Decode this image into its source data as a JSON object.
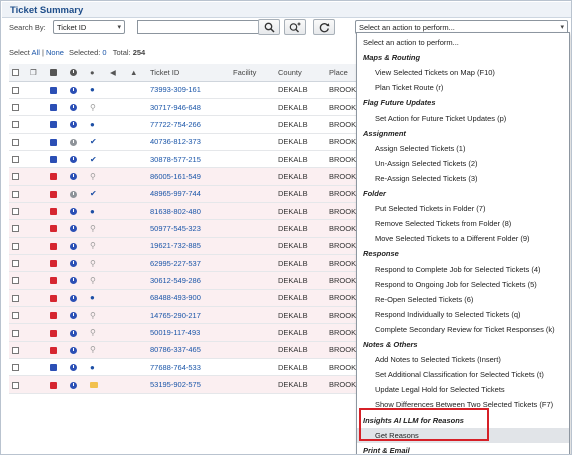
{
  "panel": {
    "title": "Ticket Summary"
  },
  "search": {
    "label": "Search By:",
    "field_value": "Ticket ID",
    "query_value": "",
    "action_select_value": "Select an action to perform..."
  },
  "selection": {
    "prefix": "Select",
    "all_label": "All",
    "none_label": "None",
    "selected_label": "Selected:",
    "selected_count": "0",
    "total_label": "Total:",
    "total_count": "254"
  },
  "table": {
    "headers": {
      "ticket_id": "Ticket ID",
      "facility": "Facility",
      "county": "County",
      "place": "Place"
    },
    "rows": [
      {
        "id": "73993-309-161",
        "county": "DEKALB",
        "place": "BROOKHA",
        "pink": false,
        "type": "blue",
        "clock": "blue",
        "person": "person"
      },
      {
        "id": "30717-946-648",
        "county": "DEKALB",
        "place": "BROOKHA",
        "pink": false,
        "type": "blue",
        "clock": "blue",
        "person": "search"
      },
      {
        "id": "77722-754-266",
        "county": "DEKALB",
        "place": "BROOKHA",
        "pink": false,
        "type": "blue",
        "clock": "blue",
        "person": "person"
      },
      {
        "id": "40736-812-373",
        "county": "DEKALB",
        "place": "BROOKHA",
        "pink": false,
        "type": "blue",
        "clock": "gray",
        "person": "check"
      },
      {
        "id": "30878-577-215",
        "county": "DEKALB",
        "place": "BROOKHA",
        "pink": false,
        "type": "blue",
        "clock": "blue",
        "person": "check"
      },
      {
        "id": "86005-161-549",
        "county": "DEKALB",
        "place": "BROOKHA",
        "pink": true,
        "type": "red",
        "clock": "blue",
        "person": "search"
      },
      {
        "id": "48965-997-744",
        "county": "DEKALB",
        "place": "BROOKHA",
        "pink": true,
        "type": "red",
        "clock": "gray",
        "person": "check"
      },
      {
        "id": "81638-802-480",
        "county": "DEKALB",
        "place": "BROOKHA",
        "pink": true,
        "type": "red",
        "clock": "blue",
        "person": "person"
      },
      {
        "id": "50977-545-323",
        "county": "DEKALB",
        "place": "BROOKHA",
        "pink": true,
        "type": "red",
        "clock": "blue",
        "person": "search"
      },
      {
        "id": "19621-732-885",
        "county": "DEKALB",
        "place": "BROOKHA",
        "pink": true,
        "type": "red",
        "clock": "blue",
        "person": "search"
      },
      {
        "id": "62995-227-537",
        "county": "DEKALB",
        "place": "BROOKHA",
        "pink": true,
        "type": "red",
        "clock": "blue",
        "person": "search"
      },
      {
        "id": "30612-549-286",
        "county": "DEKALB",
        "place": "BROOKHA",
        "pink": true,
        "type": "red",
        "clock": "blue",
        "person": "search"
      },
      {
        "id": "68488-493-900",
        "county": "DEKALB",
        "place": "BROOKHA",
        "pink": true,
        "type": "red",
        "clock": "blue",
        "person": "person"
      },
      {
        "id": "14765-290-217",
        "county": "DEKALB",
        "place": "BROOKHA",
        "pink": true,
        "type": "red",
        "clock": "blue",
        "person": "search"
      },
      {
        "id": "50019-117-493",
        "county": "DEKALB",
        "place": "BROOKHA",
        "pink": true,
        "type": "red",
        "clock": "blue",
        "person": "search"
      },
      {
        "id": "80786-337-465",
        "county": "DEKALB",
        "place": "BROOKHA",
        "pink": true,
        "type": "red",
        "clock": "blue",
        "person": "search"
      },
      {
        "id": "77688-764-533",
        "county": "DEKALB",
        "place": "BROOKHA",
        "pink": false,
        "type": "blue",
        "clock": "blue",
        "person": "person"
      },
      {
        "id": "53195-902-575",
        "county": "DEKALB",
        "place": "BROOKHA",
        "pink": true,
        "type": "red",
        "clock": "blue",
        "person": "folder"
      }
    ]
  },
  "dropdown": {
    "items": [
      {
        "label": "Select an action to perform...",
        "kind": "plain"
      },
      {
        "label": "Maps & Routing",
        "kind": "header"
      },
      {
        "label": "View Selected Tickets on Map (F10)",
        "kind": "item"
      },
      {
        "label": "Plan Ticket Route (r)",
        "kind": "item"
      },
      {
        "label": "Flag Future Updates",
        "kind": "header"
      },
      {
        "label": "Set Action for Future Ticket Updates (p)",
        "kind": "item"
      },
      {
        "label": "Assignment",
        "kind": "header"
      },
      {
        "label": "Assign Selected Tickets (1)",
        "kind": "item"
      },
      {
        "label": "Un-Assign Selected Tickets (2)",
        "kind": "item"
      },
      {
        "label": "Re-Assign Selected Tickets (3)",
        "kind": "item"
      },
      {
        "label": "Folder",
        "kind": "header"
      },
      {
        "label": "Put Selected Tickets in Folder (7)",
        "kind": "item"
      },
      {
        "label": "Remove Selected Tickets from Folder (8)",
        "kind": "item"
      },
      {
        "label": "Move Selected Tickets to a Different Folder (9)",
        "kind": "item"
      },
      {
        "label": "Response",
        "kind": "header"
      },
      {
        "label": "Respond to Complete Job for Selected Tickets (4)",
        "kind": "item"
      },
      {
        "label": "Respond to Ongoing Job for Selected Tickets (5)",
        "kind": "item"
      },
      {
        "label": "Re-Open Selected Tickets (6)",
        "kind": "item"
      },
      {
        "label": "Respond Individually to Selected Tickets (q)",
        "kind": "item"
      },
      {
        "label": "Complete Secondary Review for Ticket Responses (k)",
        "kind": "item"
      },
      {
        "label": "Notes & Others",
        "kind": "header"
      },
      {
        "label": "Add Notes to Selected Tickets (Insert)",
        "kind": "item"
      },
      {
        "label": "Set Additional Classification for Selected Tickets (t)",
        "kind": "item"
      },
      {
        "label": "Update Legal Hold for Selected Tickets",
        "kind": "item"
      },
      {
        "label": "Show Differences Between Two Selected Tickets (F7)",
        "kind": "item"
      },
      {
        "label": "Insights AI LLM for Reasons",
        "kind": "header"
      },
      {
        "label": "Get Reasons",
        "kind": "item",
        "hover": true
      },
      {
        "label": "Print & Email",
        "kind": "header"
      }
    ]
  },
  "colors": {
    "accent": "#1f4e8a",
    "link": "#1a55a8",
    "icon_blue": "#2b4fb5",
    "icon_red": "#d62630",
    "icon_gray": "#8e9399",
    "highlight_border": "#d62027",
    "pink_row": "#fbeff1"
  },
  "icons": {
    "search": "magnifier-icon",
    "add_search": "zoom-in-icon",
    "refresh": "refresh-icon",
    "dropdown": "chevron-down-icon"
  }
}
